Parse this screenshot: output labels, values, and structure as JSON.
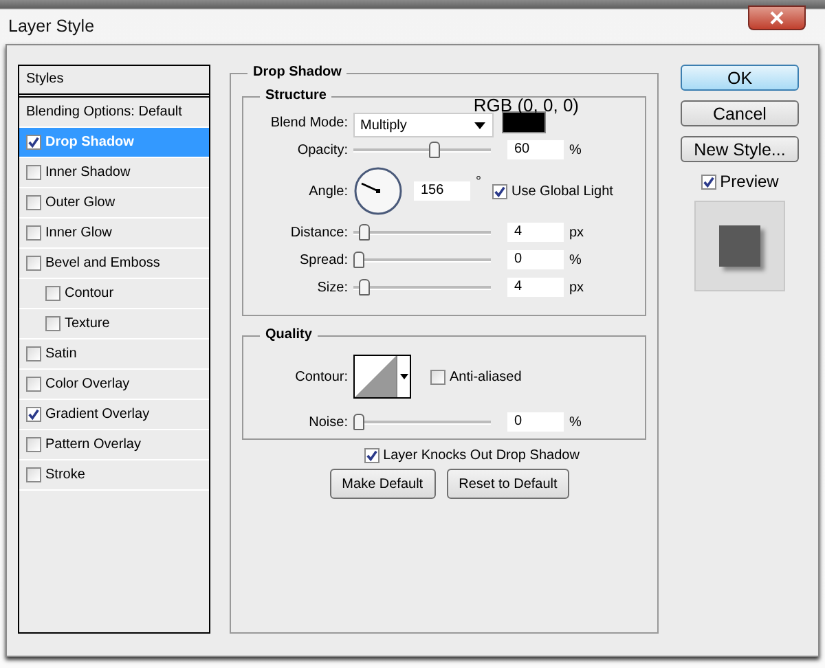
{
  "window": {
    "title": "Layer Style"
  },
  "styles_panel": {
    "header": "Styles",
    "items": [
      {
        "label": "Blending Options: Default",
        "kind": "plain",
        "selected": false
      },
      {
        "label": "Drop Shadow",
        "kind": "checkbox",
        "checked": true,
        "selected": true
      },
      {
        "label": "Inner Shadow",
        "kind": "checkbox",
        "checked": false,
        "selected": false
      },
      {
        "label": "Outer Glow",
        "kind": "checkbox",
        "checked": false,
        "selected": false
      },
      {
        "label": "Inner Glow",
        "kind": "checkbox",
        "checked": false,
        "selected": false
      },
      {
        "label": "Bevel and Emboss",
        "kind": "checkbox",
        "checked": false,
        "selected": false,
        "children": [
          {
            "label": "Contour",
            "kind": "checkbox",
            "checked": false,
            "selected": false
          },
          {
            "label": "Texture",
            "kind": "checkbox",
            "checked": false,
            "selected": false
          }
        ]
      },
      {
        "label": "Satin",
        "kind": "checkbox",
        "checked": false,
        "selected": false
      },
      {
        "label": "Color Overlay",
        "kind": "checkbox",
        "checked": false,
        "selected": false
      },
      {
        "label": "Gradient Overlay",
        "kind": "checkbox",
        "checked": true,
        "selected": false
      },
      {
        "label": "Pattern Overlay",
        "kind": "checkbox",
        "checked": false,
        "selected": false
      },
      {
        "label": "Stroke",
        "kind": "checkbox",
        "checked": false,
        "selected": false
      }
    ]
  },
  "drop_shadow": {
    "title": "Drop Shadow",
    "structure": {
      "title": "Structure",
      "color_label": "RGB (0, 0, 0)",
      "rows": [
        {
          "kind": "dropdown",
          "label": "Blend Mode:",
          "value": "Multiply",
          "color": "#000000"
        },
        {
          "kind": "slider",
          "label": "Opacity:",
          "level": 0.6,
          "value": "60",
          "unit": "%"
        },
        {
          "kind": "angle",
          "label": "Angle:",
          "value": "156",
          "unit": "°",
          "checkbox": {
            "label": "Use Global Light",
            "checked": true
          }
        },
        {
          "kind": "slider",
          "label": "Distance:",
          "level": 0.04,
          "value": "4",
          "unit": "px"
        },
        {
          "kind": "slider",
          "label": "Spread:",
          "level": 0,
          "value": "0",
          "unit": "%"
        },
        {
          "kind": "slider",
          "label": "Size:",
          "level": 0.04,
          "value": "4",
          "unit": "px"
        }
      ]
    },
    "quality": {
      "title": "Quality",
      "contour": {
        "label": "Contour:"
      },
      "anti_aliased": {
        "label": "Anti-aliased",
        "checked": false
      },
      "noise": {
        "label": "Noise:",
        "level": 0,
        "value": "0",
        "unit": "%"
      }
    },
    "knockout": {
      "label": "Layer Knocks Out Drop Shadow",
      "checked": true
    },
    "buttons": [
      "Make Default",
      "Reset to Default"
    ]
  },
  "actions": [
    {
      "label": "OK",
      "kind": "default"
    },
    {
      "label": "Cancel",
      "kind": "normal"
    },
    {
      "label": "New Style...",
      "kind": "normal"
    }
  ],
  "preview": {
    "label": "Preview",
    "checked": true
  }
}
